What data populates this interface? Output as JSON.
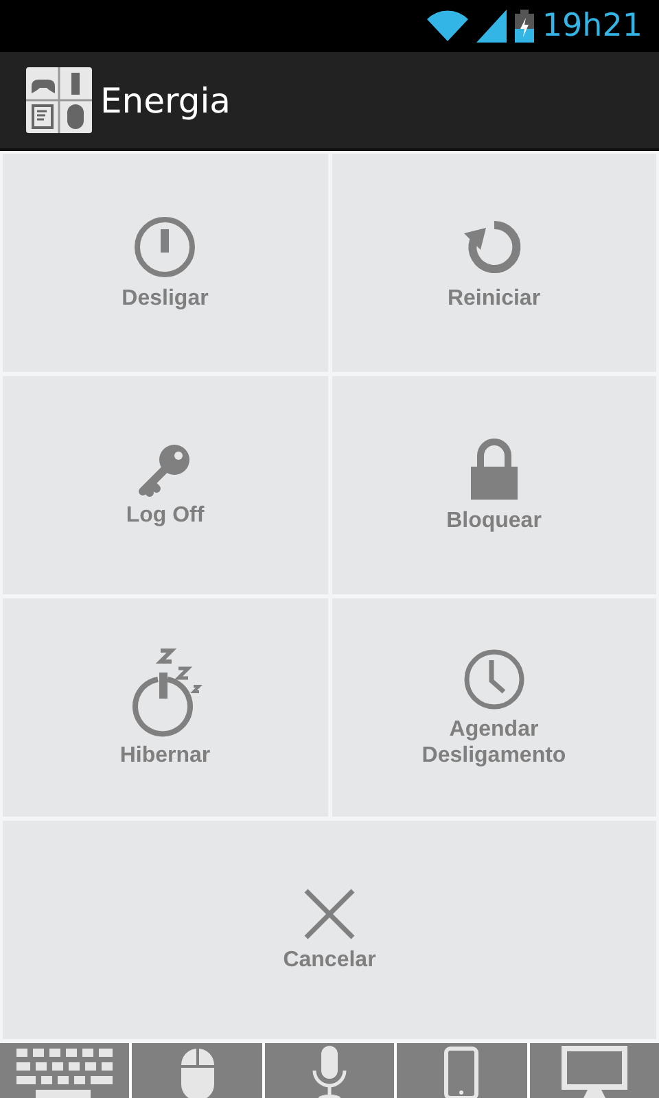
{
  "status_bar": {
    "time": "19h21"
  },
  "action_bar": {
    "title": "Energia"
  },
  "actions": [
    {
      "label": "Desligar",
      "kind": "power"
    },
    {
      "label": "Reiniciar",
      "kind": "restart"
    },
    {
      "label": "Log Off",
      "kind": "key"
    },
    {
      "label": "Bloquear",
      "kind": "lock"
    },
    {
      "label": "Hibernar",
      "kind": "sleep"
    },
    {
      "label": "Agendar Desligamento",
      "kind": "clock"
    },
    {
      "label": "Cancelar",
      "kind": "cancel"
    }
  ],
  "bottom_tabs": [
    {
      "kind": "keyboard"
    },
    {
      "kind": "mouse"
    },
    {
      "kind": "mic"
    },
    {
      "kind": "phone"
    },
    {
      "kind": "monitor"
    }
  ]
}
